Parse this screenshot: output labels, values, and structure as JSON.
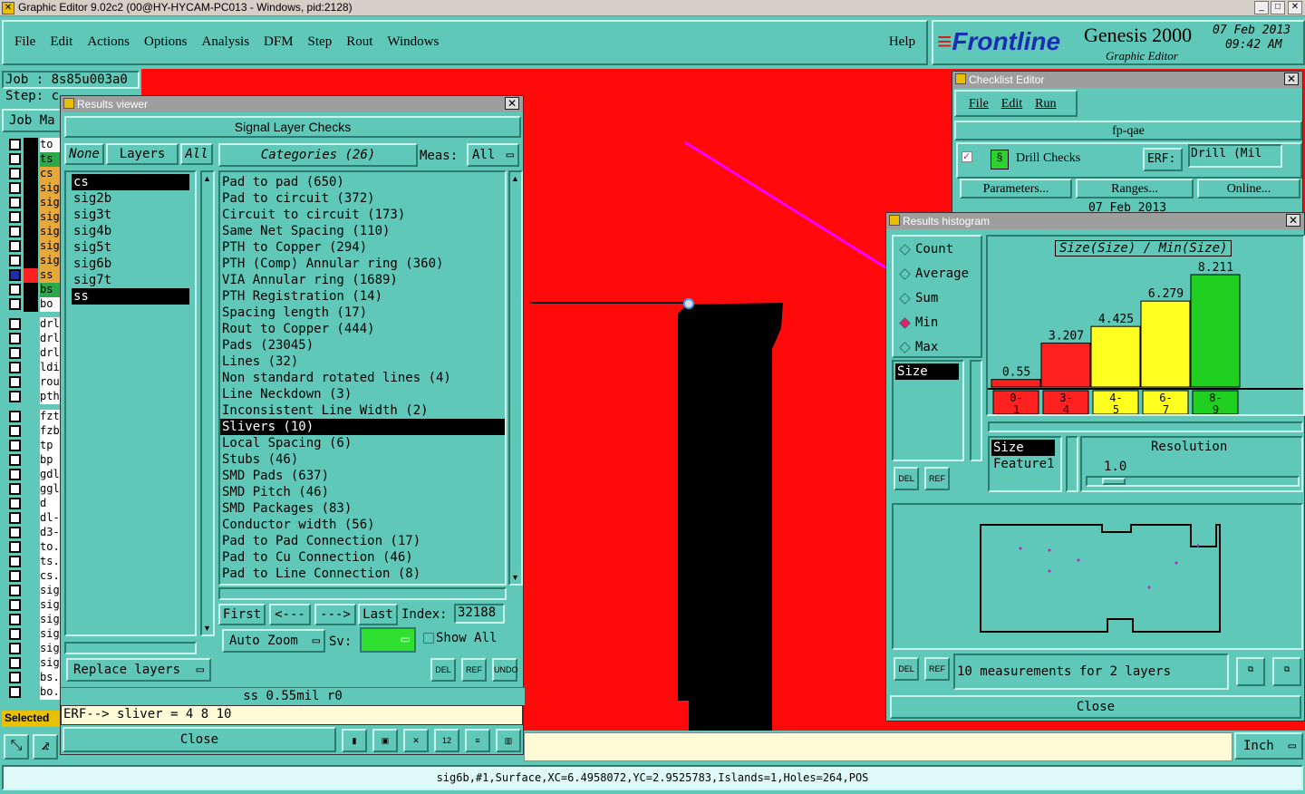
{
  "window": {
    "title": "Graphic Editor 9.02c2 (00@HY-HYCAM-PC013 - Windows, pid:2128)"
  },
  "menu": {
    "items": [
      "File",
      "Edit",
      "Actions",
      "Options",
      "Analysis",
      "DFM",
      "Step",
      "Rout",
      "Windows"
    ],
    "help": "Help"
  },
  "brand": {
    "logo": "Frontline",
    "product": "Genesis 2000",
    "subtitle": "Graphic Editor",
    "date": "07 Feb 2013",
    "time": "09:42 AM"
  },
  "job": {
    "label": "Job : 8s85u003a0",
    "step": "Step: c",
    "job_matrix": "Job Ma",
    "selected": "Selected"
  },
  "layers_side": {
    "group1": [
      {
        "n": "to",
        "c": "#ffffff"
      },
      {
        "n": "ts",
        "c": "#2aa84a"
      },
      {
        "n": "cs",
        "c": "#e8a838"
      },
      {
        "n": "sig",
        "c": "#e8a838"
      },
      {
        "n": "sig",
        "c": "#e8a838"
      },
      {
        "n": "sig",
        "c": "#e8a838"
      },
      {
        "n": "sig",
        "c": "#e8a838"
      },
      {
        "n": "sig",
        "c": "#e8a838"
      },
      {
        "n": "sig",
        "c": "#e8a838"
      },
      {
        "n": "ss",
        "c": "#e8a838"
      },
      {
        "n": "bs",
        "c": "#2aa84a"
      },
      {
        "n": "bo",
        "c": "#ffffff"
      }
    ],
    "group2": [
      "drl",
      "drl",
      "drl",
      "ldi",
      "rou",
      "pth"
    ],
    "group3": [
      "fzt",
      "fzb",
      "tp",
      "bp",
      "gdl",
      "ggl",
      "d",
      "dl-",
      "d3-",
      "to.",
      "ts.",
      "cs.",
      "sig",
      "sig",
      "sig",
      "sig",
      "sig",
      "sig",
      "bs.",
      "bo."
    ]
  },
  "results_viewer": {
    "title": "Results viewer",
    "header": "Signal Layer Checks",
    "none": "None",
    "layers": "Layers",
    "all": "All",
    "layer_list": [
      "cs",
      "sig2b",
      "sig3t",
      "sig4b",
      "sig5t",
      "sig6b",
      "sig7t",
      "ss"
    ],
    "categories_label": "Categories (26)",
    "meas_label": "Meas:",
    "meas_value": "All",
    "categories": [
      "Pad to pad (650)",
      "Pad to circuit (372)",
      "Circuit to circuit (173)",
      "Same Net Spacing (110)",
      "PTH to Copper (294)",
      "PTH (Comp) Annular ring (360)",
      "VIA Annular ring (1689)",
      "PTH Registration (14)",
      "Spacing length (17)",
      "Rout to Copper (444)",
      "Pads (23045)",
      "Lines (32)",
      "Non standard rotated lines (4)",
      "Line Neckdown (3)",
      "Inconsistent Line Width (2)",
      "Slivers (10)",
      "Local Spacing (6)",
      "Stubs (46)",
      "SMD Pads (637)",
      "SMD Pitch (46)",
      "SMD Packages (83)",
      "Conductor width (56)",
      "Pad to Pad Connection (17)",
      "Pad to Cu Connection (46)",
      "Pad to Line Connection (8)"
    ],
    "selected_category": "Slivers (10)",
    "first": "First",
    "prev": "<---",
    "next": "--->",
    "last": "Last",
    "index_label": "Index:",
    "index_value": "32188",
    "auto_zoom": "Auto Zoom",
    "sv": "Sv:",
    "show_all": "Show All",
    "replace_layers": "Replace layers",
    "del": "DEL",
    "ref": "REF",
    "undo": "UNDO",
    "status": "ss 0.55mil  r0",
    "erf": "ERF--> sliver = 4 8 10",
    "close": "Close"
  },
  "checklist": {
    "title": "Checklist Editor",
    "menu": [
      "File",
      "Edit",
      "Run"
    ],
    "name": "fp-qae",
    "check": "Drill Checks",
    "erf_label": "ERF:",
    "erf_value": "Drill (Mil",
    "parameters": "Parameters...",
    "ranges": "Ranges...",
    "online": "Online...",
    "date": "07 Feb 2013"
  },
  "histogram": {
    "title": "Results histogram",
    "modes": [
      "Count",
      "Average",
      "Sum",
      "Min",
      "Max"
    ],
    "selected_mode": "Min",
    "list1": [
      "Size"
    ],
    "chart_title": "Size(Size) / Min(Size)",
    "list2": [
      "Size",
      "Feature1"
    ],
    "resolution_label": "Resolution",
    "resolution_value": "1.0",
    "measure_text": "10 measurements for 2 layers",
    "close": "Close",
    "del": "DEL",
    "ref": "REF"
  },
  "chart_data": {
    "type": "bar",
    "title": "Size(Size) / Min(Size)",
    "categories": [
      "0-1",
      "3-4",
      "4-5",
      "6-7",
      "8-9"
    ],
    "values": [
      0.55,
      3.207,
      4.425,
      6.279,
      8.211
    ],
    "value_labels": [
      "0.55",
      "3.207",
      "4.425",
      "6.279",
      "8.211"
    ],
    "colors": [
      "#ff2020",
      "#ff2020",
      "#ffff20",
      "#ffff20",
      "#20d020"
    ],
    "ylim": [
      0,
      8.211
    ]
  },
  "units": {
    "value": "Inch"
  },
  "statusbar": {
    "text": "sig6b,#1,Surface,XC=6.4958072,YC=2.9525783,Islands=1,Holes=264,POS"
  },
  "colors": {
    "canvas": "#ff0a0a",
    "panel": "#5fc8b8",
    "arrow": "#ff00ff"
  }
}
